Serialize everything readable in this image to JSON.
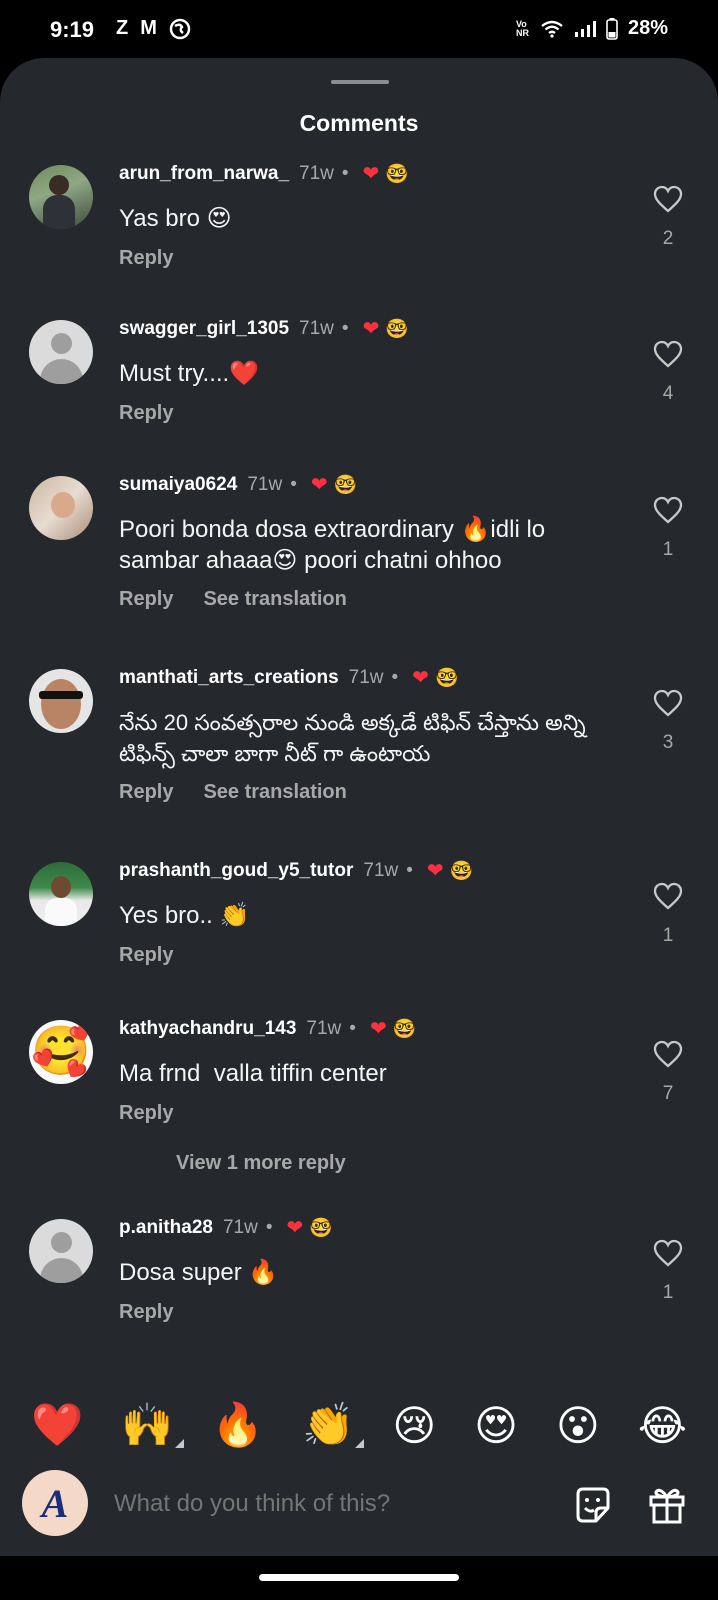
{
  "status_bar": {
    "time": "9:19",
    "left_icons": [
      "Z",
      "M"
    ],
    "network": "Vo NR",
    "battery": "28%"
  },
  "sheet": {
    "title": "Comments"
  },
  "comments": [
    {
      "username": "arun_from_narwa_",
      "time": "71w",
      "text": "Yas bro 😍",
      "reply": "Reply",
      "translate": "",
      "likes": "2",
      "creator_emoji": "🤓"
    },
    {
      "username": "swagger_girl_1305",
      "time": "71w",
      "text": "Must try....❤️",
      "reply": "Reply",
      "translate": "",
      "likes": "4",
      "creator_emoji": "🤓"
    },
    {
      "username": "sumaiya0624",
      "time": "71w",
      "text": "Poori bonda dosa extraordinary 🔥idli lo sambar ahaaa😍 poori chatni ohhoo",
      "reply": "Reply",
      "translate": "See translation",
      "likes": "1",
      "creator_emoji": "🤓"
    },
    {
      "username": "manthati_arts_creations",
      "time": "71w",
      "text": "నేను 20 సంవత్సరాల నుండి అక్కడే టిఫిన్ చేస్తాను అన్ని టిఫిన్స్ చాలా బాగా నీట్ గా ఉంటాయ",
      "reply": "Reply",
      "translate": "See translation",
      "likes": "3",
      "creator_emoji": "🤓"
    },
    {
      "username": "prashanth_goud_y5_tutor",
      "time": "71w",
      "text": "Yes bro.. 👏",
      "reply": "Reply",
      "translate": "",
      "likes": "1",
      "creator_emoji": "🤓"
    },
    {
      "username": "kathyachandru_143",
      "time": "71w",
      "text": "Ma frnd  valla tiffin center",
      "reply": "Reply",
      "translate": "",
      "likes": "7",
      "creator_emoji": "🤓",
      "view_more": "View 1 more reply"
    },
    {
      "username": "p.anitha28",
      "time": "71w",
      "text": "Dosa super 🔥",
      "reply": "Reply",
      "translate": "",
      "likes": "1",
      "creator_emoji": "🤓"
    }
  ],
  "reactions": [
    "❤️",
    "🙌",
    "🔥",
    "👏",
    "😢",
    "😍",
    "😮",
    "😂"
  ],
  "composer": {
    "avatar_letter": "A",
    "placeholder": "What do you think of this?"
  }
}
